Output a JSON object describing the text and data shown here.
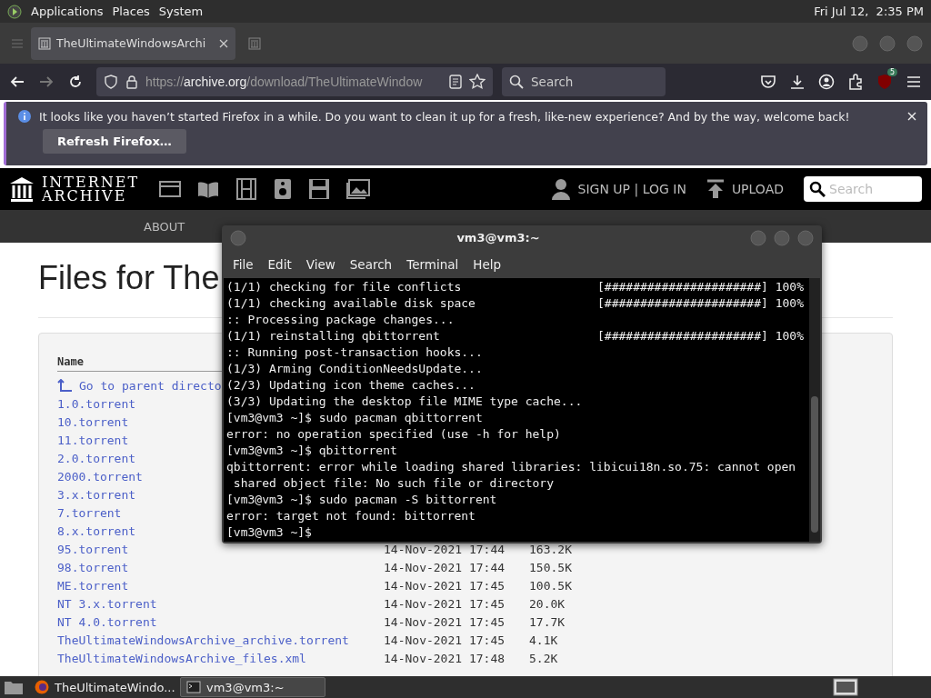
{
  "top_panel": {
    "menus": [
      "Applications",
      "Places",
      "System"
    ],
    "clock": "Fri Jul 12,  2:35 PM"
  },
  "browser": {
    "tabs": [
      {
        "title": "TheUltimateWindowsArchi",
        "selected": true
      },
      {
        "selected": false
      }
    ],
    "url": {
      "scheme": "https://",
      "host": "archive.org",
      "path": "/download/TheUltimateWindow"
    },
    "search_placeholder": "Search",
    "extension_badge": "5",
    "notification": {
      "message": "It looks like you haven’t started Firefox in a while. Do you want to clean it up for a fresh, like-new experience? And by the way, welcome back!",
      "button": "Refresh Firefox…"
    }
  },
  "site": {
    "logo": [
      "INTERNET",
      "ARCHIVE"
    ],
    "account": "SIGN UP | LOG IN",
    "upload": "UPLOAD",
    "search_placeholder": "Search",
    "nav": [
      "ABOUT"
    ]
  },
  "page": {
    "heading": "Files for The",
    "columns": [
      "Name"
    ],
    "rows": [
      {
        "name": "Go to parent directo",
        "kind": "parent"
      },
      {
        "name": "1.0.torrent",
        "kind": "file"
      },
      {
        "name": "10.torrent",
        "kind": "file"
      },
      {
        "name": "11.torrent",
        "kind": "file"
      },
      {
        "name": "2.0.torrent",
        "kind": "file"
      },
      {
        "name": "2000.torrent",
        "kind": "file"
      },
      {
        "name": "3.x.torrent",
        "kind": "file"
      },
      {
        "name": "7.torrent",
        "kind": "file"
      },
      {
        "name": "8.x.torrent",
        "kind": "file"
      },
      {
        "name": "95.torrent",
        "kind": "file",
        "date": "14-Nov-2021 17:44",
        "size": "163.2K"
      },
      {
        "name": "98.torrent",
        "kind": "file",
        "date": "14-Nov-2021 17:44",
        "size": "150.5K"
      },
      {
        "name": "ME.torrent",
        "kind": "file",
        "date": "14-Nov-2021 17:45",
        "size": "100.5K"
      },
      {
        "name": "NT 3.x.torrent",
        "kind": "file",
        "date": "14-Nov-2021 17:45",
        "size": "20.0K"
      },
      {
        "name": "NT 4.0.torrent",
        "kind": "file",
        "date": "14-Nov-2021 17:45",
        "size": "17.7K"
      },
      {
        "name": "TheUltimateWindowsArchive_archive.torrent",
        "kind": "file",
        "date": "14-Nov-2021 17:45",
        "size": "4.1K"
      },
      {
        "name": "TheUltimateWindowsArchive_files.xml",
        "kind": "file",
        "date": "14-Nov-2021 17:48",
        "size": "5.2K"
      }
    ]
  },
  "terminal": {
    "title": "vm3@vm3:~",
    "menus": [
      "File",
      "Edit",
      "View",
      "Search",
      "Terminal",
      "Help"
    ],
    "lines": [
      {
        "text": "(1/1) checking for file conflicts",
        "progress": "[######################] 100%"
      },
      {
        "text": "(1/1) checking available disk space",
        "progress": "[######################] 100%"
      },
      {
        "text": ":: Processing package changes..."
      },
      {
        "text": "(1/1) reinstalling qbittorrent",
        "progress": "[######################] 100%"
      },
      {
        "text": ":: Running post-transaction hooks..."
      },
      {
        "text": "(1/3) Arming ConditionNeedsUpdate..."
      },
      {
        "text": "(2/3) Updating icon theme caches..."
      },
      {
        "text": "(3/3) Updating the desktop file MIME type cache..."
      },
      {
        "text": "[vm3@vm3 ~]$ sudo pacman qbittorrent"
      },
      {
        "text": "error: no operation specified (use -h for help)"
      },
      {
        "text": "[vm3@vm3 ~]$ qbittorrent"
      },
      {
        "text": "qbittorrent: error while loading shared libraries: libicui18n.so.75: cannot open"
      },
      {
        "text": " shared object file: No such file or directory"
      },
      {
        "text": "[vm3@vm3 ~]$ sudo pacman -S bittorrent"
      },
      {
        "text": "error: target not found: bittorrent"
      },
      {
        "text": "[vm3@vm3 ~]$"
      }
    ]
  },
  "taskbar": {
    "items": [
      {
        "label": "TheUltimateWindo...",
        "kind": "browser",
        "selected": false
      },
      {
        "label": "vm3@vm3:~",
        "kind": "terminal",
        "selected": true
      }
    ]
  }
}
